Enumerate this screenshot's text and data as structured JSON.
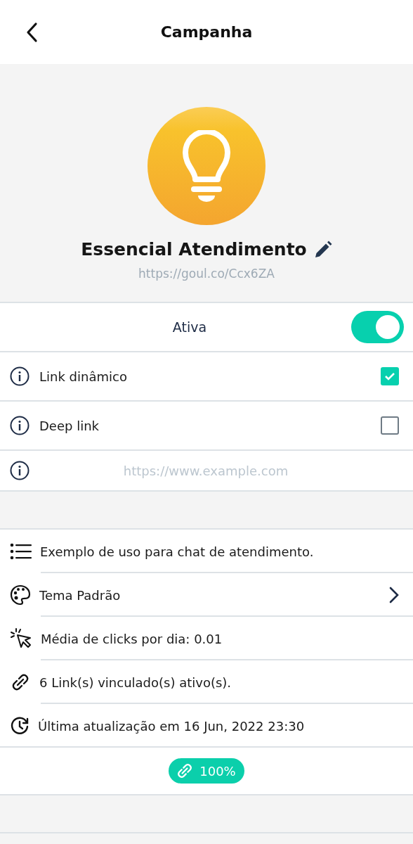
{
  "header": {
    "title": "Campanha"
  },
  "campaign": {
    "name": "Essencial Atendimento",
    "url": "https://goul.co/Ccx6ZA"
  },
  "active": {
    "label": "Ativa",
    "on": true
  },
  "options": [
    {
      "label": "Link dinâmico",
      "checked": true
    },
    {
      "label": "Deep link",
      "checked": false
    }
  ],
  "deep_link_field": {
    "placeholder": "https://www.example.com"
  },
  "details": [
    {
      "kind": "list",
      "text": "Exemplo de uso para chat de atendimento.",
      "chevron": false
    },
    {
      "kind": "palette",
      "text": "Tema Padrão",
      "chevron": true
    },
    {
      "kind": "cursor",
      "text": "Média de clicks por dia: 0.01",
      "chevron": false
    },
    {
      "kind": "link",
      "text": "6 Link(s) vinculado(s) ativo(s).",
      "chevron": false
    },
    {
      "kind": "history",
      "text": "Última atualização em 16 Jun, 2022 23:30",
      "chevron": false
    }
  ],
  "badge": {
    "text": "100%"
  }
}
